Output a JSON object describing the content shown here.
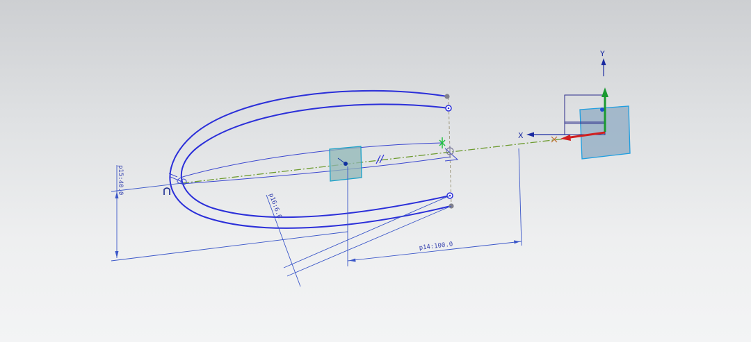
{
  "sketch": {
    "dimensions": {
      "p15": "p15:40.0",
      "p16": "p16:6.0",
      "p14": "p14:100.0"
    },
    "csys": {
      "x_label": "X",
      "y_label": "Y"
    }
  },
  "colors": {
    "curve": "#2b2fd9",
    "dimension": "#3a56c8",
    "centerline": "#6c9a2e",
    "x_axis": "#d02020",
    "y_axis": "#1a9a30",
    "plane": "#9cb4c8"
  }
}
